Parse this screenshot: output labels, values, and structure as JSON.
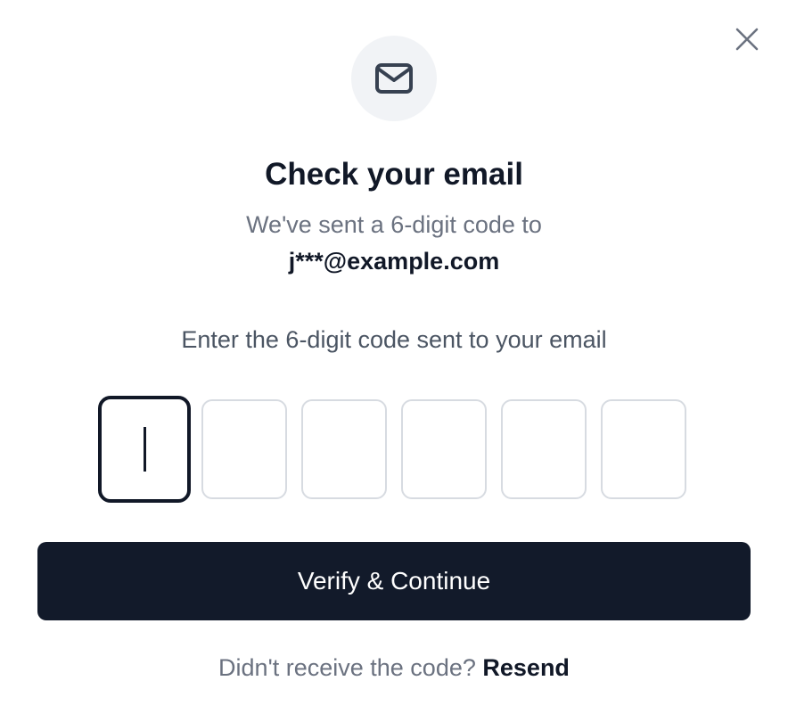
{
  "dialog": {
    "close_icon": "close-icon",
    "header_icon": "mail-icon",
    "title": "Check your email",
    "subtitle": "We've sent a 6-digit code to",
    "email": "j***@example.com",
    "instruction": "Enter the 6-digit code sent to your email",
    "code_digits": [
      "",
      "",
      "",
      "",
      "",
      ""
    ],
    "active_digit_index": 0,
    "verify_label": "Verify & Continue",
    "resend_prompt": "Didn't receive the code?",
    "resend_label": "Resend"
  },
  "colors": {
    "primary": "#121a2a",
    "text": "#111827",
    "muted": "#6b7280",
    "border": "#d7dbe1",
    "icon_bg": "#f1f3f6"
  }
}
